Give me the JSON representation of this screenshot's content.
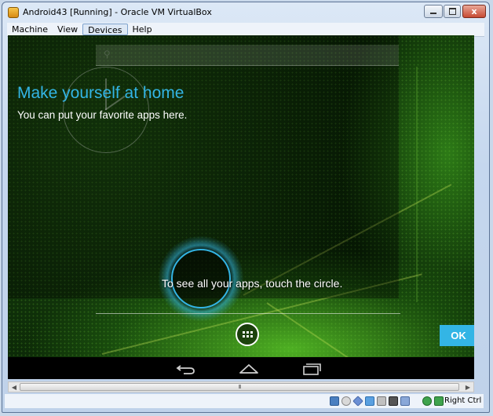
{
  "window": {
    "title": "Android43 [Running] - Oracle VM VirtualBox",
    "minimize_label": "–",
    "restore_label": "□",
    "close_label": "x"
  },
  "menubar": {
    "items": [
      "Machine",
      "View",
      "Devices",
      "Help"
    ]
  },
  "android": {
    "cling_title": "Make yourself at home",
    "cling_subtitle": "You can put your favorite apps here.",
    "apps_hint": "To see all your apps, touch the circle.",
    "ok_button": "OK"
  },
  "scrollbar": {
    "grip": "III"
  },
  "statusbar": {
    "host_key": "Right Ctrl",
    "icons": [
      "hard-disk-icon",
      "optical-drive-icon",
      "usb-icon",
      "shared-folders-icon",
      "display-icon",
      "video-capture-icon",
      "network-icon",
      "virtualization-icon",
      "mouse-integration-icon"
    ]
  },
  "colors": {
    "accent_holo_blue": "#33b5e5",
    "navbar": "#000000",
    "window_frame": "#c5d7ee"
  }
}
